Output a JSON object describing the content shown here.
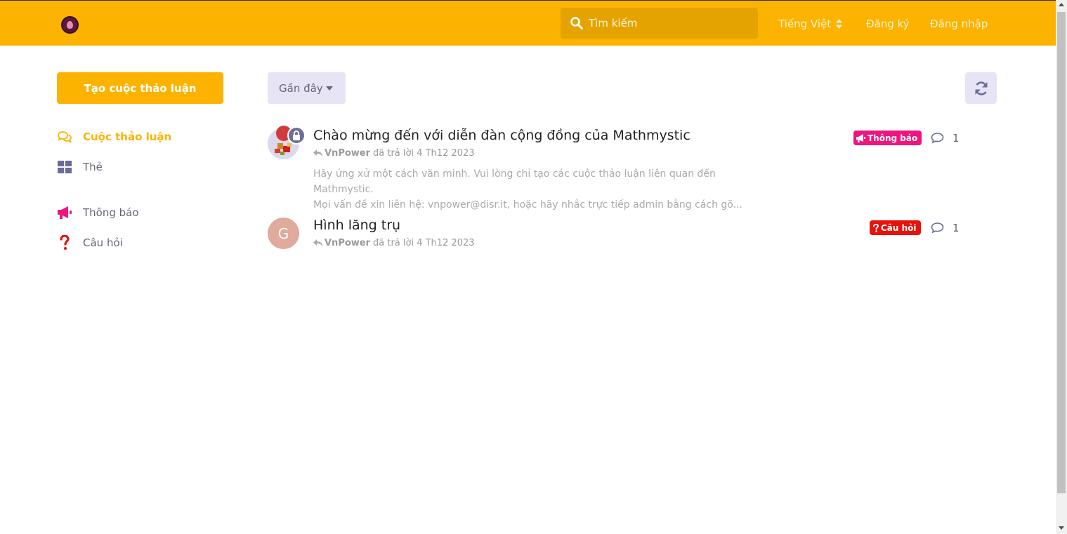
{
  "header": {
    "search_placeholder": "Tìm kiếm",
    "language": "Tiếng Việt",
    "signup": "Đăng ký",
    "login": "Đăng nhập",
    "color": "#fbb300"
  },
  "sidebar": {
    "new_discussion": "Tạo cuộc thảo luận",
    "items": [
      {
        "label": "Cuộc thảo luận",
        "icon": "comments-icon",
        "active": true
      },
      {
        "label": "Thẻ",
        "icon": "tags-grid-icon",
        "active": false
      },
      {
        "label": "Thông báo",
        "icon": "megaphone-icon",
        "active": false
      },
      {
        "label": "Câu hỏi",
        "icon": "question-icon",
        "active": false
      }
    ]
  },
  "toolbar": {
    "sort_label": "Gần đây",
    "refresh_icon": "refresh-icon"
  },
  "discussions": [
    {
      "title": "Chào mừng đến với diễn đàn cộng đồng của Mathmystic",
      "author": "VnPower",
      "meta": "đã trả lời 4 Th12 2023",
      "excerpt_line1": "Hãy ứng xử một cách văn minh. Vui lòng chỉ tạo các cuộc thảo luận liên quan đến Mathmystic.",
      "excerpt_line2": "Mọi vấn đề xin liên hệ: vnpower@disr.it, hoặc hãy nhắc trực tiếp admin bằng cách gõ...",
      "tag": "Thông báo",
      "tag_color": "#f0147e",
      "replies": "1"
    },
    {
      "title": "Hình lăng trụ",
      "author": "VnPower",
      "meta": "đã trả lời 4 Th12 2023",
      "avatar_letter": "G",
      "tag": "Câu hỏi",
      "tag_color": "#e8120c",
      "replies": "1"
    }
  ]
}
